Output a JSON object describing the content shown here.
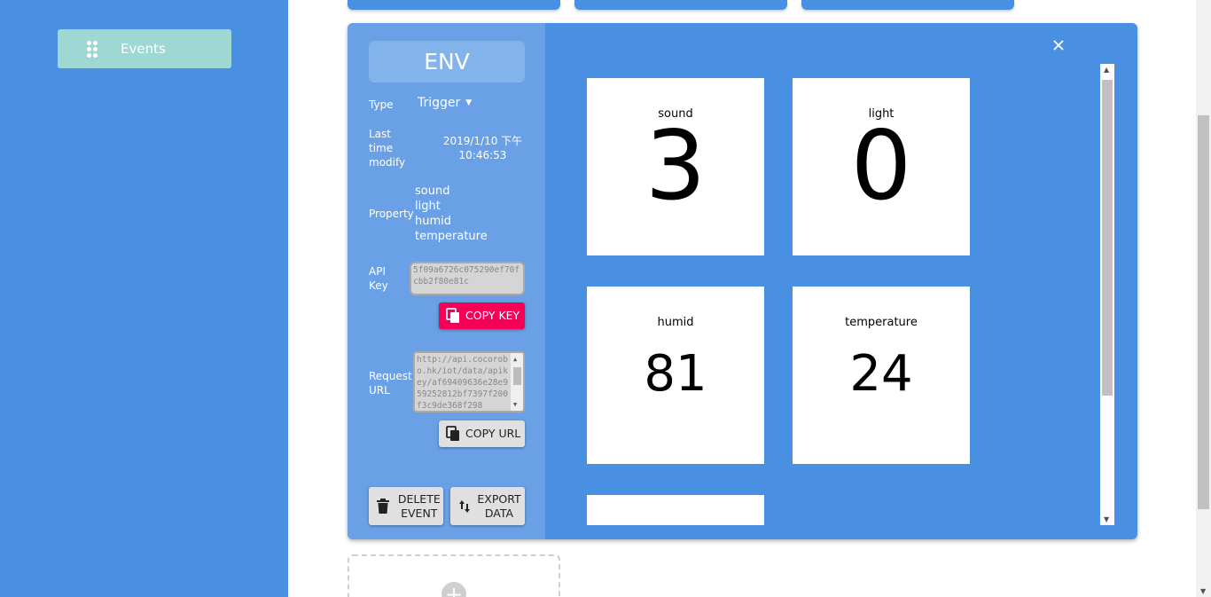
{
  "sidebar": {
    "items": [
      {
        "label": "Events",
        "icon": "drag-handle-icon"
      }
    ]
  },
  "event": {
    "title": "ENV",
    "type_label": "Type",
    "type_value": "Trigger",
    "modified_label": "Last time modify",
    "modified_date": "2019/1/10 下午",
    "modified_time": "10:46:53",
    "property_label": "Property",
    "properties": [
      "sound",
      "light",
      "humid",
      "temperature"
    ],
    "api_key_label": "API Key",
    "api_key": "5f09a6726c075290ef70fcbb2f80e81c",
    "copy_key_label": "COPY KEY",
    "request_url_label": "Request URL",
    "request_url": "http://api.cocorobo.hk/iot/data/apikey/af69409636e28e959252812bf7397f200f3c9de368f298",
    "copy_url_label": "COPY URL",
    "delete_label": "DELETE EVENT",
    "export_label": "EXPORT DATA"
  },
  "tiles": [
    {
      "name": "sound",
      "value": "3"
    },
    {
      "name": "light",
      "value": "0"
    },
    {
      "name": "humid",
      "value": "81"
    },
    {
      "name": "temperature",
      "value": "24"
    }
  ],
  "colors": {
    "primary": "#4a90e2",
    "panel_left": "#6aa1e6",
    "accent_pink": "#f50057",
    "nav_active": "#9fd8d2"
  }
}
